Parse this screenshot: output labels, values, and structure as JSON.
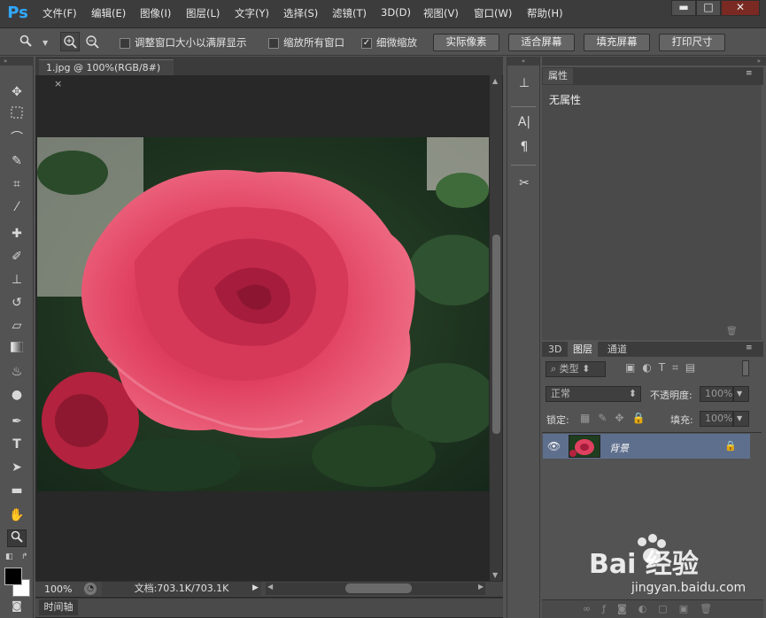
{
  "app": {
    "logo": "Ps"
  },
  "menu": [
    "文件(F)",
    "编辑(E)",
    "图像(I)",
    "图层(L)",
    "文字(Y)",
    "选择(S)",
    "滤镜(T)",
    "3D(D)",
    "视图(V)",
    "窗口(W)",
    "帮助(H)"
  ],
  "window_controls": {
    "minimize": "▬",
    "maximize": "□",
    "close": "✕"
  },
  "options": {
    "checkbox1": {
      "label": "调整窗口大小以满屏显示",
      "checked": false
    },
    "checkbox2": {
      "label": "缩放所有窗口",
      "checked": false
    },
    "checkbox3": {
      "label": "细微缩放",
      "checked": true
    },
    "buttons": [
      "实际像素",
      "适合屏幕",
      "填充屏幕",
      "打印尺寸"
    ]
  },
  "document": {
    "tab_title": "1.jpg @ 100%(RGB/8#)",
    "tab_close": "×"
  },
  "status": {
    "zoom": "100%",
    "doc_info": "文档:703.1K/703.1K"
  },
  "timeline": {
    "label": "时间轴"
  },
  "properties": {
    "tab": "属性",
    "content": "无属性"
  },
  "layers": {
    "tabs": [
      "3D",
      "图层",
      "通道"
    ],
    "filter_type": "类型",
    "blend_mode": "正常",
    "opacity_label": "不透明度:",
    "opacity_value": "100%",
    "lock_label": "锁定:",
    "fill_label": "填充:",
    "fill_value": "100%",
    "layer_name": "背景"
  },
  "watermark": {
    "brand": "Bai 经验",
    "url": "jingyan.baidu.com"
  },
  "icons": [
    "zoom-icon",
    "zoom-in-icon",
    "zoom-out-icon",
    "move-tool-icon",
    "marquee-icon",
    "lasso-icon",
    "quick-select-icon",
    "crop-icon",
    "eyedropper-icon",
    "healing-icon",
    "brush-icon",
    "stamp-icon",
    "history-brush-icon",
    "eraser-icon",
    "gradient-icon",
    "blur-icon",
    "dodge-icon",
    "pen-icon",
    "type-icon",
    "path-select-icon",
    "shape-icon",
    "hand-icon",
    "zoom-tool-icon",
    "eye-icon",
    "lock-icon"
  ]
}
